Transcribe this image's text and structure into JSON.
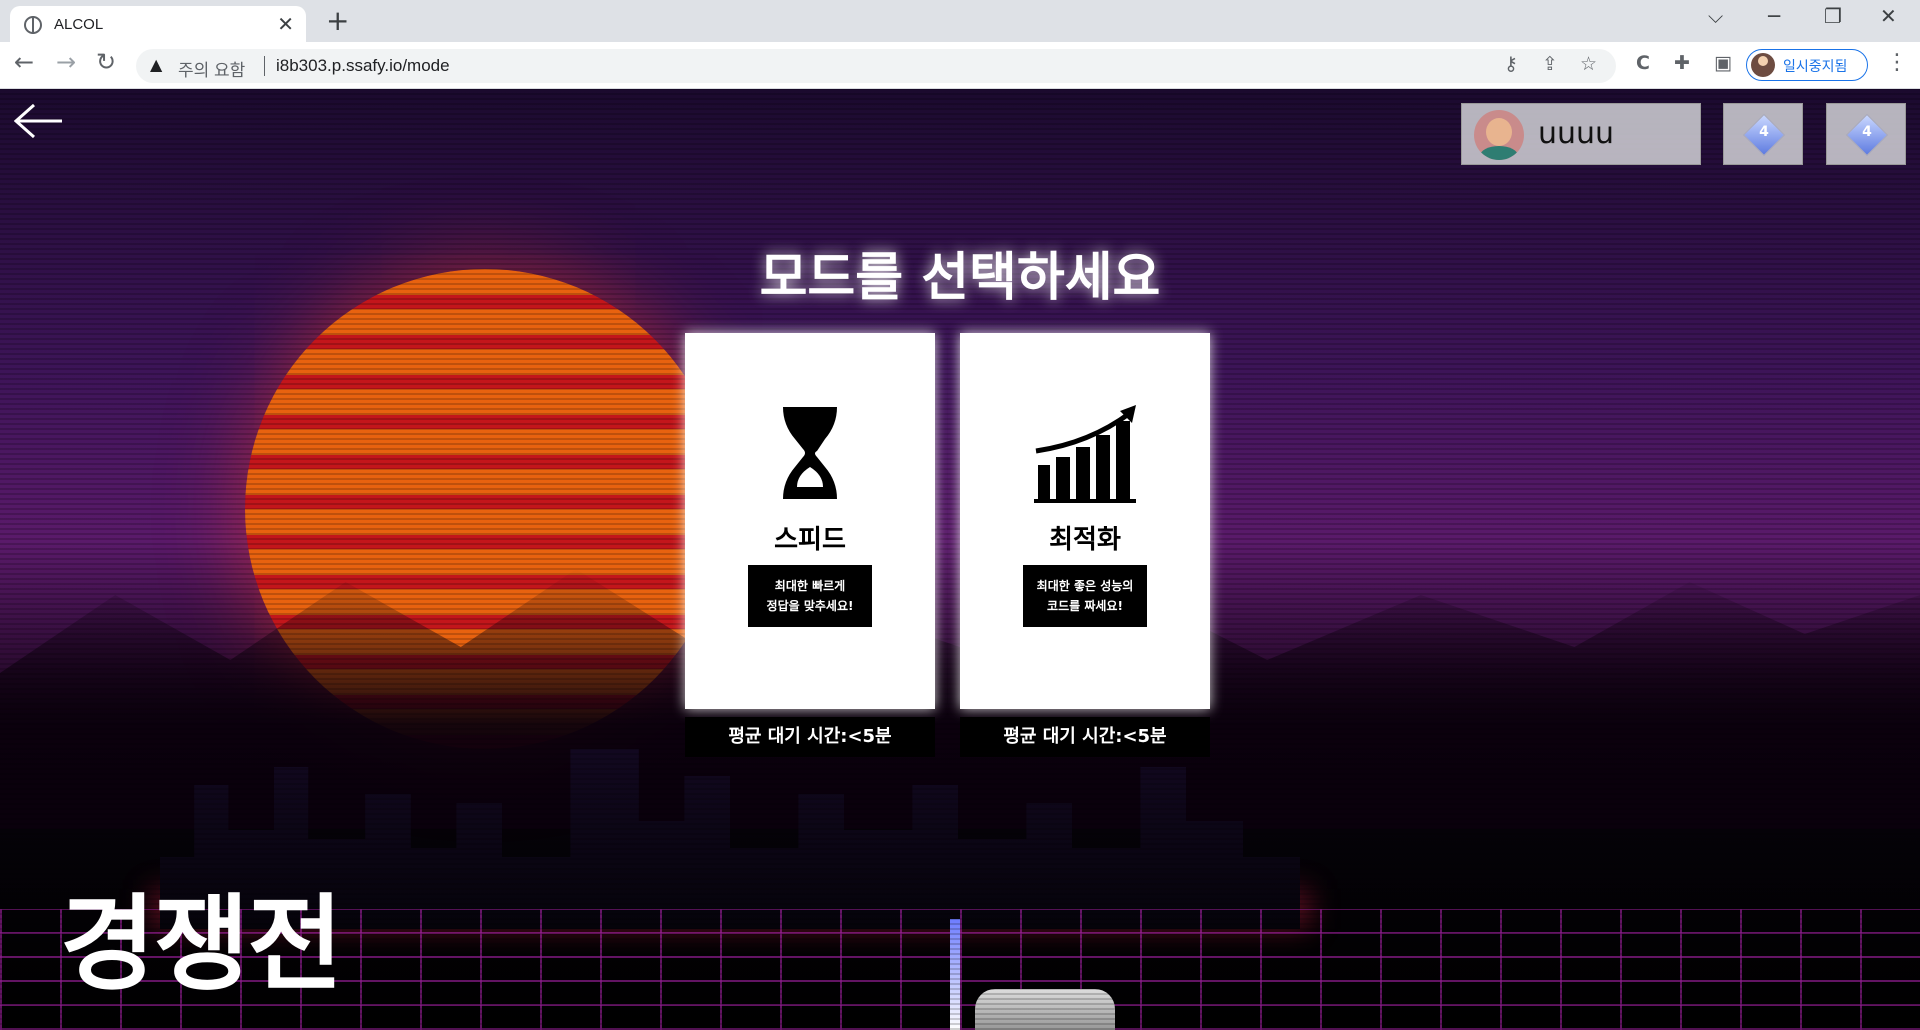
{
  "browser": {
    "tab_title": "ALCOL",
    "tab_close": "✕",
    "new_tab": "+",
    "window_controls": {
      "tab_search": "⌵",
      "minimize": "─",
      "restore": "❐",
      "close": "✕"
    },
    "nav": {
      "back": "←",
      "forward": "→",
      "reload": "↻"
    },
    "security_warning": "주의 요함",
    "url": "i8b303.p.ssafy.io/mode",
    "omnibox_icons": {
      "key": "⚷",
      "share": "⇪",
      "bookmark": "☆"
    },
    "toolbar_icons": {
      "extension_c": "C",
      "extensions": "✚",
      "side_panel": "▣"
    },
    "profile_label": "일시중지됨",
    "menu": "⋮"
  },
  "page": {
    "back_arrow_icon": "arrow-left-icon",
    "user": {
      "name": "uuuu"
    },
    "gems": [
      {
        "value": "4"
      },
      {
        "value": "4"
      }
    ],
    "heading": "모드를 선택하세요",
    "modes": [
      {
        "title": "스피드",
        "icon": "hourglass-icon",
        "description": "최대한 빠르게\n정답을 맞추세요!",
        "wait": "평균 대기 시간:<5분"
      },
      {
        "title": "최적화",
        "icon": "growth-chart-icon",
        "description": "최대한 좋은 성능의\n코드를 짜세요!",
        "wait": "평균 대기 시간:<5분"
      }
    ],
    "big_title": "경쟁전"
  },
  "colors": {
    "accent": "#ffffff",
    "sun_orange": "#e8620f",
    "sun_red": "#c3161b",
    "sky_purple": "#5a1a6a",
    "profile_blue": "#1a73e8"
  }
}
